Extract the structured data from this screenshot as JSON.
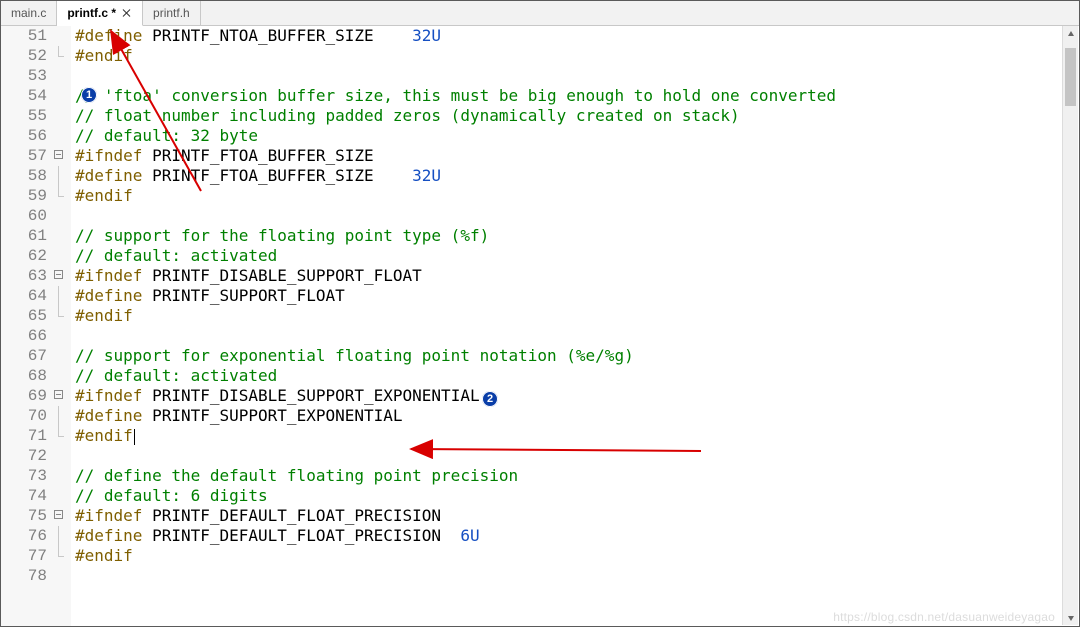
{
  "tabs": [
    {
      "label": "main.c",
      "active": false,
      "dirty": false
    },
    {
      "label": "printf.c",
      "active": true,
      "dirty": true
    },
    {
      "label": "printf.h",
      "active": false,
      "dirty": false
    }
  ],
  "badges": {
    "b1": "1",
    "b2": "2"
  },
  "watermark": "https://blog.csdn.net/dasuanweideyagao",
  "code": {
    "lines": [
      {
        "n": "51",
        "fold": "",
        "seg": [
          [
            "dir",
            "#define"
          ],
          [
            "id",
            " PRINTF_NTOA_BUFFER_SIZE    "
          ],
          [
            "num",
            "32U"
          ]
        ]
      },
      {
        "n": "52",
        "fold": "end",
        "seg": [
          [
            "dir",
            "#endif"
          ]
        ]
      },
      {
        "n": "53",
        "fold": "",
        "seg": []
      },
      {
        "n": "54",
        "fold": "",
        "seg": [
          [
            "cmt",
            "// 'ftoa' conversion buffer size, this must be big enough to hold one converted"
          ]
        ]
      },
      {
        "n": "55",
        "fold": "",
        "seg": [
          [
            "cmt",
            "// float number including padded zeros (dynamically created on stack)"
          ]
        ]
      },
      {
        "n": "56",
        "fold": "",
        "seg": [
          [
            "cmt",
            "// default: 32 byte"
          ]
        ]
      },
      {
        "n": "57",
        "fold": "open",
        "seg": [
          [
            "dir",
            "#ifndef"
          ],
          [
            "id",
            " PRINTF_FTOA_BUFFER_SIZE"
          ]
        ]
      },
      {
        "n": "58",
        "fold": "bar",
        "seg": [
          [
            "dir",
            "#define"
          ],
          [
            "id",
            " PRINTF_FTOA_BUFFER_SIZE    "
          ],
          [
            "num",
            "32U"
          ]
        ]
      },
      {
        "n": "59",
        "fold": "end",
        "seg": [
          [
            "dir",
            "#endif"
          ]
        ]
      },
      {
        "n": "60",
        "fold": "",
        "seg": []
      },
      {
        "n": "61",
        "fold": "",
        "seg": [
          [
            "cmt",
            "// support for the floating point type (%f)"
          ]
        ]
      },
      {
        "n": "62",
        "fold": "",
        "seg": [
          [
            "cmt",
            "// default: activated"
          ]
        ]
      },
      {
        "n": "63",
        "fold": "open",
        "seg": [
          [
            "dir",
            "#ifndef"
          ],
          [
            "id",
            " PRINTF_DISABLE_SUPPORT_FLOAT"
          ]
        ]
      },
      {
        "n": "64",
        "fold": "bar",
        "seg": [
          [
            "dir",
            "#define"
          ],
          [
            "id",
            " PRINTF_SUPPORT_FLOAT"
          ]
        ]
      },
      {
        "n": "65",
        "fold": "end",
        "seg": [
          [
            "dir",
            "#endif"
          ]
        ]
      },
      {
        "n": "66",
        "fold": "",
        "seg": []
      },
      {
        "n": "67",
        "fold": "",
        "seg": [
          [
            "cmt",
            "// support for exponential floating point notation (%e/%g)"
          ]
        ]
      },
      {
        "n": "68",
        "fold": "",
        "seg": [
          [
            "cmt",
            "// default: activated"
          ]
        ]
      },
      {
        "n": "69",
        "fold": "open",
        "seg": [
          [
            "dir",
            "#ifndef"
          ],
          [
            "id",
            " PRINTF_DISABLE_SUPPORT_EXPONENTIAL"
          ]
        ]
      },
      {
        "n": "70",
        "fold": "bar",
        "seg": [
          [
            "dir",
            "#define"
          ],
          [
            "id",
            " PRINTF_SUPPORT_EXPONENTIAL"
          ]
        ]
      },
      {
        "n": "71",
        "fold": "end",
        "seg": [
          [
            "dir",
            "#endif"
          ]
        ],
        "cursor": true
      },
      {
        "n": "72",
        "fold": "",
        "seg": []
      },
      {
        "n": "73",
        "fold": "",
        "seg": [
          [
            "cmt",
            "// define the default floating point precision"
          ]
        ]
      },
      {
        "n": "74",
        "fold": "",
        "seg": [
          [
            "cmt",
            "// default: 6 digits"
          ]
        ]
      },
      {
        "n": "75",
        "fold": "open",
        "seg": [
          [
            "dir",
            "#ifndef"
          ],
          [
            "id",
            " PRINTF_DEFAULT_FLOAT_PRECISION"
          ]
        ]
      },
      {
        "n": "76",
        "fold": "bar",
        "seg": [
          [
            "dir",
            "#define"
          ],
          [
            "id",
            " PRINTF_DEFAULT_FLOAT_PRECISION  "
          ],
          [
            "num",
            "6U"
          ]
        ]
      },
      {
        "n": "77",
        "fold": "end",
        "seg": [
          [
            "dir",
            "#endif"
          ]
        ]
      },
      {
        "n": "78",
        "fold": "",
        "seg": []
      }
    ]
  }
}
